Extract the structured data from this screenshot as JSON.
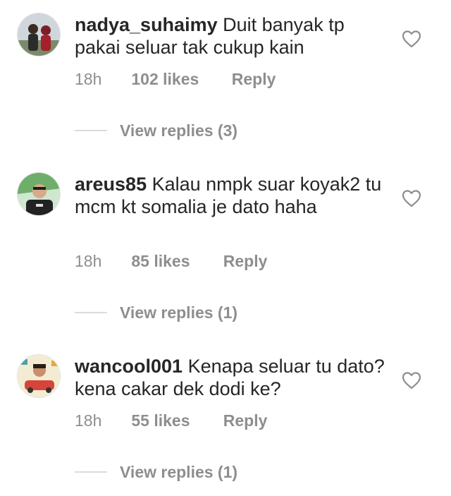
{
  "comments": [
    {
      "username": "nadya_suhaimy",
      "text": "Duit banyak tp pakai seluar tak cukup kain",
      "time": "18h",
      "likes": "102 likes",
      "reply": "Reply",
      "view_replies": "View replies (3)",
      "avatar_icon": "user-avatar",
      "like_icon": "heart-outline-icon"
    },
    {
      "username": "areus85",
      "text": "Kalau nmpk suar koyak2 tu mcm kt somalia je dato haha",
      "time": "18h",
      "likes": "85 likes",
      "reply": "Reply",
      "view_replies": "View replies (1)",
      "avatar_icon": "user-avatar",
      "like_icon": "heart-outline-icon"
    },
    {
      "username": "wancool001",
      "text": "Kenapa seluar tu dato?kena cakar dek dodi ke?",
      "time": "18h",
      "likes": "55 likes",
      "reply": "Reply",
      "view_replies": "View replies (1)",
      "avatar_icon": "user-avatar",
      "like_icon": "heart-outline-icon"
    }
  ],
  "colors": {
    "text": "#262626",
    "secondary": "#8e8e8e",
    "divider": "#dbdbdb"
  }
}
